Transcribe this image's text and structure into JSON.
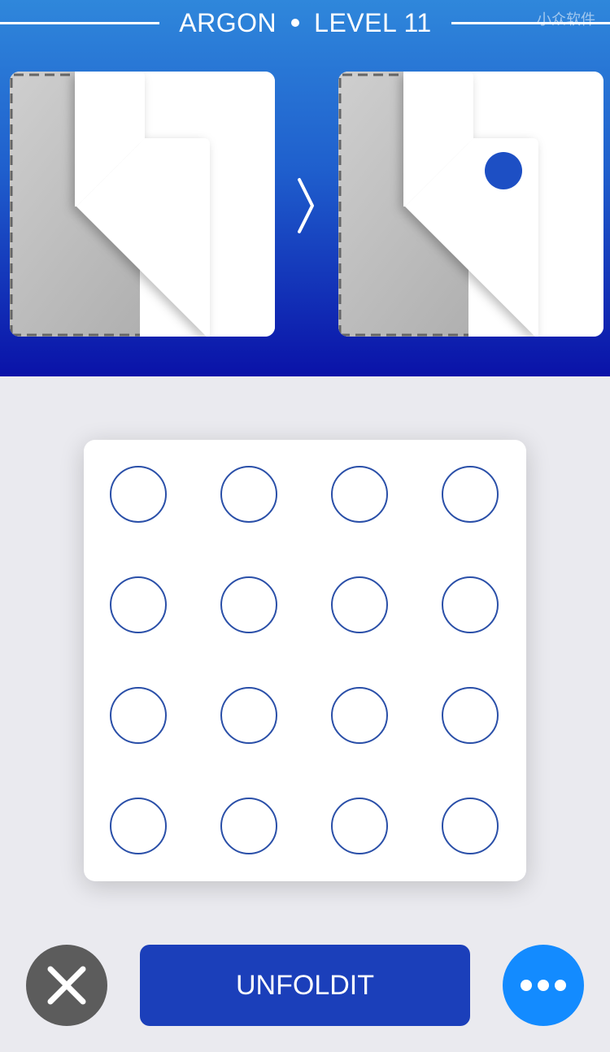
{
  "header": {
    "world": "ARGON",
    "level": "LEVEL 11",
    "watermark": "小众软件"
  },
  "puzzle": {
    "before_icon": "folded-paper-icon",
    "after_icon": "folded-paper-with-hole-icon",
    "arrow_icon": "chevron-right-icon",
    "hole_color": "#1d4fc4"
  },
  "grid": {
    "rows": 4,
    "cols": 4,
    "ring_color": "#2a4fa8"
  },
  "controls": {
    "close_icon": "close-icon",
    "primary_label": "UNFOLDIT",
    "more_icon": "more-icon"
  }
}
